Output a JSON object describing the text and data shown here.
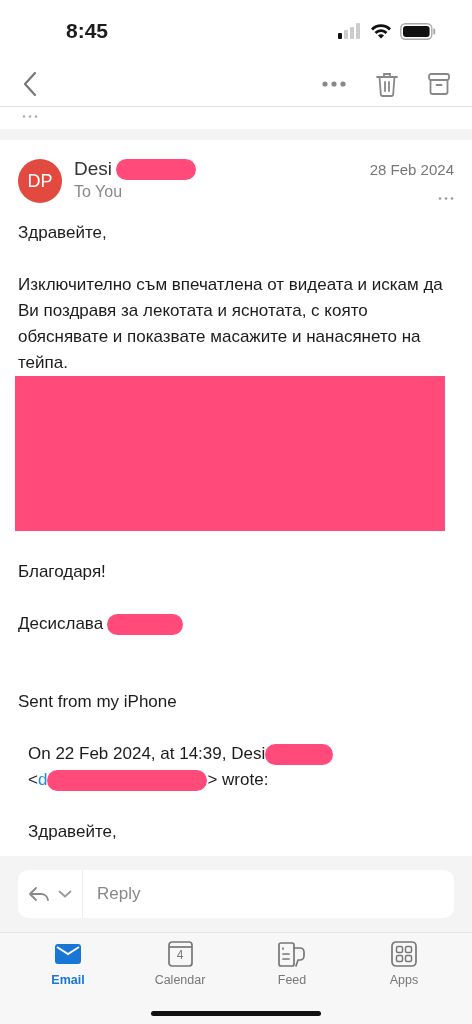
{
  "status_bar": {
    "time": "8:45"
  },
  "message": {
    "avatar_initials": "DP",
    "sender": "Desi",
    "sender_redacted": true,
    "recipient": "To You",
    "date": "28 Feb 2024"
  },
  "body": [
    {
      "kind": "text",
      "text": "Здравейте,"
    },
    {
      "kind": "text",
      "text": "Изключително съм впечатлена от видеата и искам да Ви поздравя за лекотата и яснотата, с която обяснявате и показвате масажите и нанасянето на тейпа."
    },
    {
      "kind": "redacted_block"
    },
    {
      "kind": "text",
      "text": "Благодаря!"
    },
    {
      "kind": "signature",
      "text": "Десислава",
      "redacted": true
    },
    {
      "kind": "footer",
      "text": "Sent from my iPhone"
    }
  ],
  "quote": {
    "header": "On 22 Feb 2024, at 14:39, Desi",
    "header_redacted": true,
    "address_prefix": "<",
    "link_text": "d",
    "link_redacted": true,
    "address_suffix": "> wrote:",
    "text": "Здравейте,"
  },
  "reply_field": {
    "placeholder": "Reply"
  },
  "tabs": [
    {
      "kind": "email",
      "label": "Email",
      "selected": true
    },
    {
      "kind": "calendar",
      "label": "Calendar",
      "selected": false,
      "day": "4"
    },
    {
      "kind": "feed",
      "label": "Feed",
      "selected": false
    },
    {
      "kind": "apps",
      "label": "Apps",
      "selected": false
    }
  ]
}
